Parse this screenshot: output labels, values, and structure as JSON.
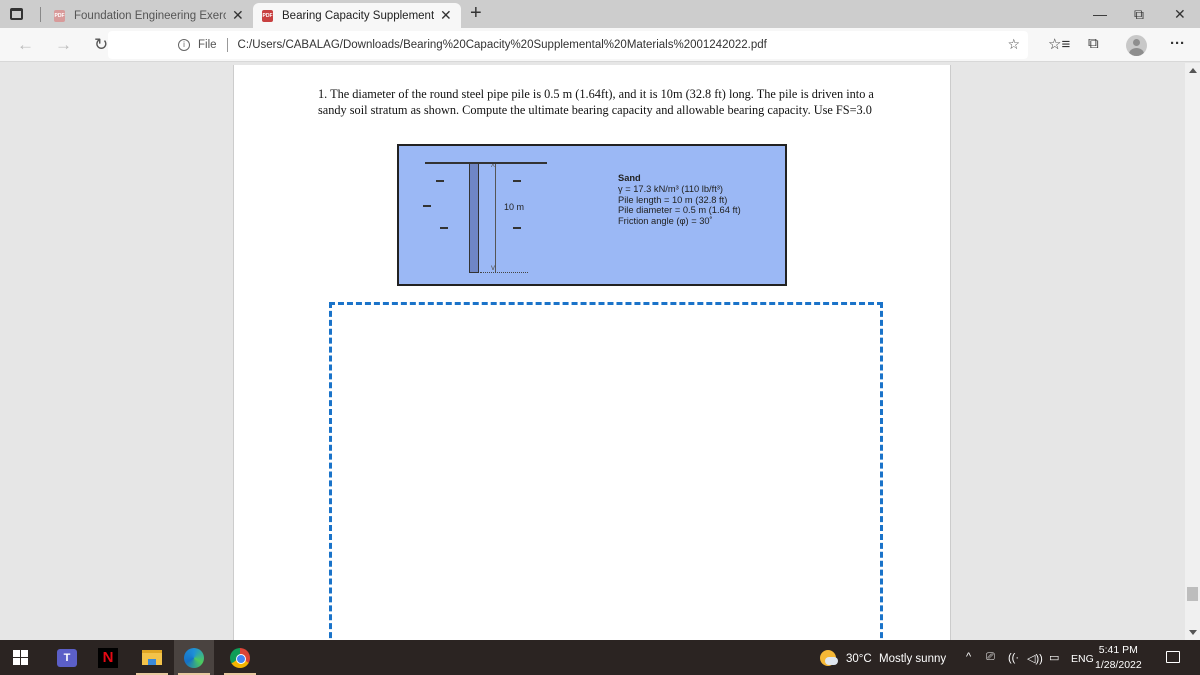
{
  "browser": {
    "tabs": [
      {
        "title": "Foundation Engineering Exercise",
        "icon": "pdf-icon",
        "active": false
      },
      {
        "title": "Bearing Capacity Supplemental M",
        "icon": "pdf-icon",
        "active": true
      }
    ],
    "new_tab_label": "+",
    "window_controls": {
      "minimize": "—",
      "restore": "⧉",
      "close": "✕"
    },
    "address": {
      "scheme_label": "File",
      "url": "C:/Users/CABALAG/Downloads/Bearing%20Capacity%20Supplemental%20Materials%2001242022.pdf"
    },
    "nav": {
      "back": "←",
      "forward": "→",
      "refresh": "↻",
      "home": "⌂"
    },
    "toolbar_icons": {
      "favorites": "☆≡",
      "collections": "⧉",
      "more": "···",
      "add_favorite": "☆"
    }
  },
  "document": {
    "question": "1. The diameter of the round steel pipe pile is 0.5 m (1.64ft), and it is 10m (32.8 ft) long. The pile is driven into a sandy soil stratum as shown. Compute the ultimate bearing capacity and allowable bearing capacity.  Use FS=3.0",
    "figure": {
      "dimension_label": "10 m",
      "soil_title": "Sand",
      "properties": [
        "γ = 17.3 kN/m³ (110 lb/ft³)",
        "Pile length = 10 m (32.8 ft)",
        "Pile diameter = 0.5 m (1.64 ft)",
        "Friction angle (φ) = 30˚"
      ],
      "colors": {
        "background": "#9bb8f5",
        "pile": "#6f86c6"
      }
    },
    "answer_box_color": "#1a73c9"
  },
  "taskbar": {
    "apps": [
      "start",
      "teams",
      "netflix",
      "file-explorer",
      "edge",
      "chrome"
    ],
    "teams_label": "T",
    "netflix_label": "N",
    "weather": {
      "temp": "30°C",
      "condition": "Mostly sunny"
    },
    "tray": {
      "chevron": "^",
      "language": "ENG",
      "wifi": "((·",
      "volume": "◁))",
      "battery": "▭"
    },
    "clock": {
      "time": "5:41 PM",
      "date": "1/28/2022"
    }
  }
}
